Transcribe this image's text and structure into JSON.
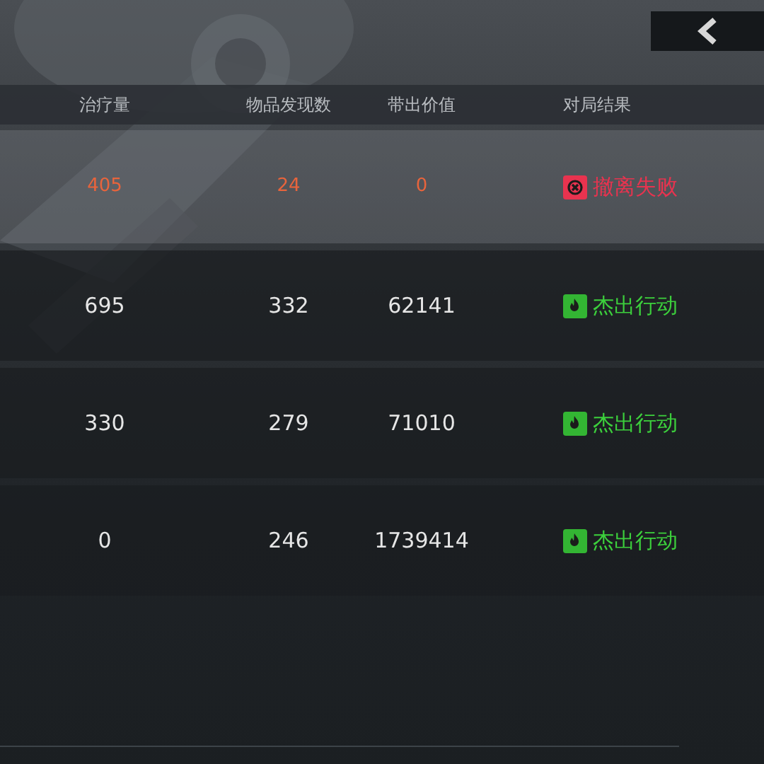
{
  "columns": [
    "治疗量",
    "物品发现数",
    "带出价值",
    "对局结果"
  ],
  "rows": [
    {
      "selected": true,
      "cells": [
        "405",
        "24",
        "0"
      ],
      "result": {
        "kind": "fail",
        "label": "撤离失败"
      }
    },
    {
      "selected": false,
      "cells": [
        "695",
        "332",
        "62141"
      ],
      "result": {
        "kind": "success",
        "label": "杰出行动"
      }
    },
    {
      "selected": false,
      "cells": [
        "330",
        "279",
        "71010"
      ],
      "result": {
        "kind": "success",
        "label": "杰出行动"
      }
    },
    {
      "selected": false,
      "cells": [
        "0",
        "246",
        "1739414"
      ],
      "result": {
        "kind": "success",
        "label": "杰出行动"
      }
    }
  ]
}
